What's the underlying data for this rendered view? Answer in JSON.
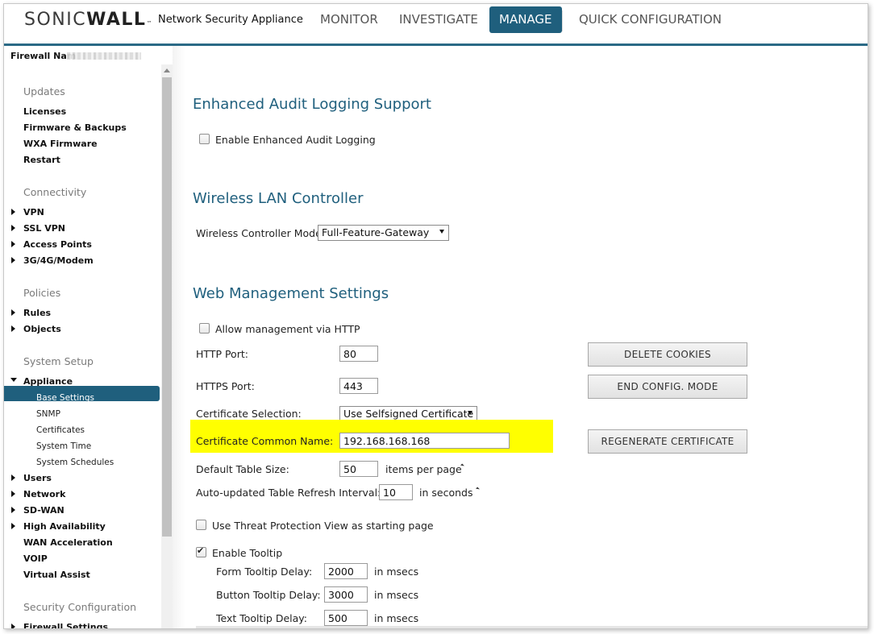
{
  "header": {
    "logo_light": "SONIC",
    "logo_bold": "WALL",
    "logo_tm": "™",
    "product": "Network Security Appliance",
    "nav": [
      {
        "label": "MONITOR",
        "active": false
      },
      {
        "label": "INVESTIGATE",
        "active": false
      },
      {
        "label": "MANAGE",
        "active": true
      },
      {
        "label": "QUICK CONFIGURATION",
        "active": false
      }
    ],
    "accent_color": "#1f5f7d"
  },
  "firewall_name_label": "Firewall Nam",
  "sidebar": {
    "groups": [
      {
        "heading": "Updates",
        "items": [
          "Licenses",
          "Firmware & Backups",
          "WXA Firmware",
          "Restart"
        ]
      },
      {
        "heading": "Connectivity",
        "items": [
          "VPN",
          "SSL VPN",
          "Access Points",
          "3G/4G/Modem"
        ]
      },
      {
        "heading": "Policies",
        "items": [
          "Rules",
          "Objects"
        ]
      },
      {
        "heading": "System Setup",
        "items": [
          "Appliance",
          "Users",
          "Network",
          "SD-WAN",
          "High Availability",
          "WAN Acceleration",
          "VOIP",
          "Virtual Assist"
        ]
      },
      {
        "heading": "Security Configuration",
        "items": [
          "Firewall Settings"
        ]
      }
    ],
    "appliance_sub": [
      "Base Settings",
      "SNMP",
      "Certificates",
      "System Time",
      "System Schedules"
    ],
    "active_item": "Base Settings"
  },
  "audit": {
    "title": "Enhanced Audit Logging Support",
    "enable_label": "Enable Enhanced Audit Logging",
    "enabled": false
  },
  "wlan": {
    "title": "Wireless LAN Controller",
    "mode_label": "Wireless Controller Mode:",
    "mode_value": "Full-Feature-Gateway"
  },
  "web": {
    "title": "Web Management Settings",
    "allow_http_label": "Allow management via HTTP",
    "allow_http": false,
    "http_port_label": "HTTP Port:",
    "http_port": "80",
    "https_port_label": "HTTPS Port:",
    "https_port": "443",
    "cert_sel_label": "Certificate Selection:",
    "cert_sel_value": "Use Selfsigned Certificate",
    "cert_cn_label": "Certificate Common Name:",
    "cert_cn_value": "192.168.168.168",
    "table_size_label": "Default Table Size:",
    "table_size": "50",
    "table_size_unit": "items per page",
    "refresh_label": "Auto-updated Table Refresh Interval:",
    "refresh": "10",
    "refresh_unit": "in seconds",
    "threat_view_label": "Use Threat Protection View as starting page",
    "threat_view": false,
    "tooltip_label": "Enable Tooltip",
    "tooltip": true,
    "form_delay_label": "Form Tooltip Delay:",
    "form_delay": "2000",
    "button_delay_label": "Button Tooltip Delay:",
    "button_delay": "3000",
    "text_delay_label": "Text Tooltip Delay:",
    "text_delay": "500",
    "msecs_unit": "in msecs",
    "highlight_color": "#ffff00"
  },
  "buttons": {
    "delete_cookies": "DELETE COOKIES",
    "end_config": "END CONFIG. MODE",
    "regenerate_cert": "REGENERATE CERTIFICATE"
  }
}
